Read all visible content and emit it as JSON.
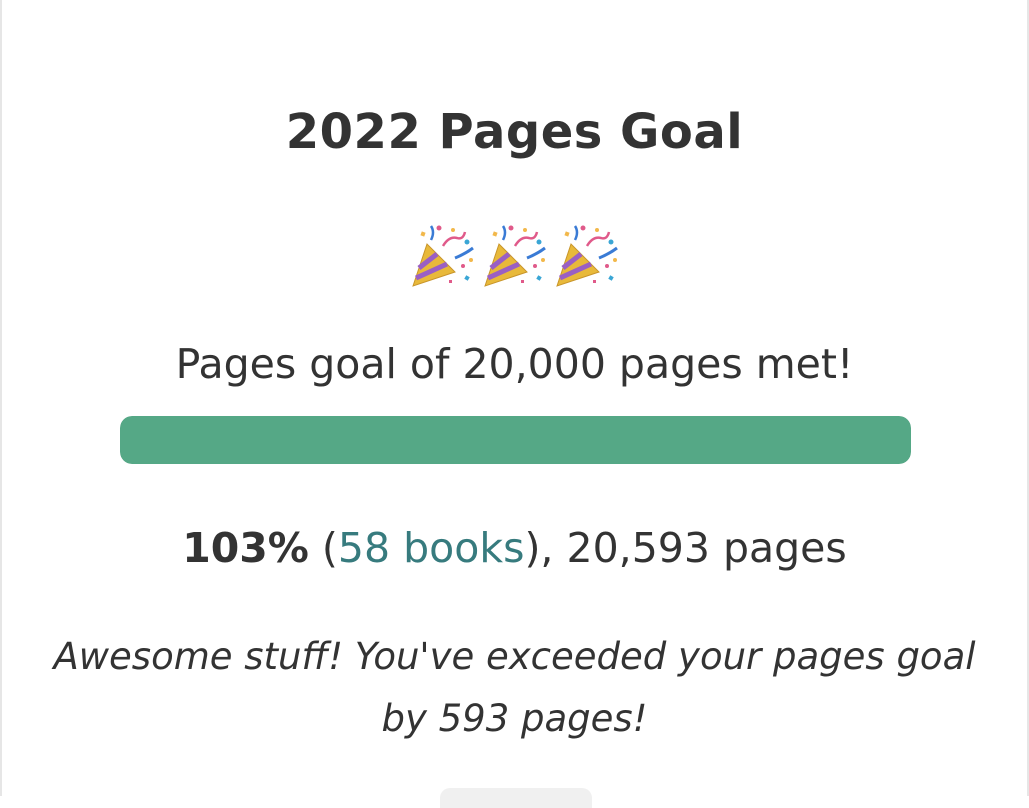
{
  "goal_card": {
    "title": "2022 Pages Goal",
    "celebration_icons": [
      "party-popper-icon",
      "party-popper-icon",
      "party-popper-icon"
    ],
    "goal_met_text": "Pages goal of 20,000 pages met!",
    "progress_fraction": 1.0,
    "progress_color": "#55a886",
    "stats": {
      "percent": "103%",
      "open_paren": " (",
      "books_link": "58 books",
      "close_rest": "), 20,593 pages"
    },
    "message_line1": "Awesome stuff! You've exceeded your pages goal",
    "message_line2": "by 593 pages!",
    "link_color": "#377b7e"
  }
}
